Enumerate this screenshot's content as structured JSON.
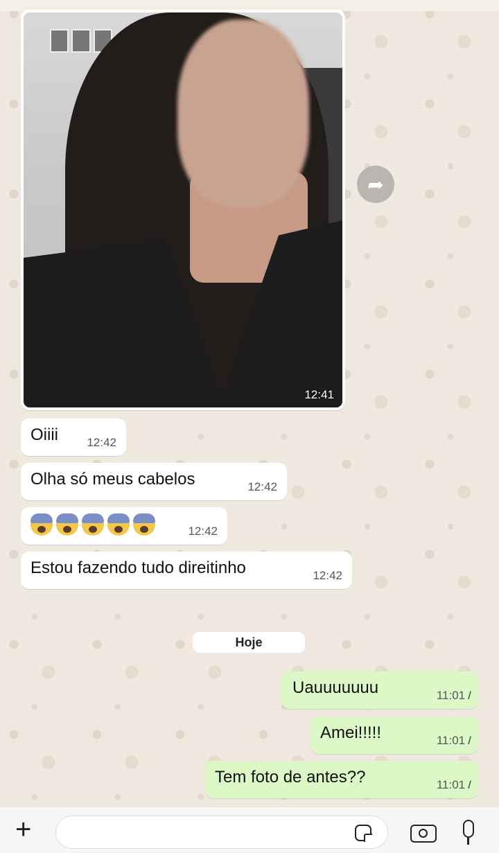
{
  "messages": {
    "photo": {
      "time": "12:41"
    },
    "incoming": [
      {
        "text": "Oiiii",
        "time": "12:42"
      },
      {
        "text": "Olha só meus cabelos",
        "time": "12:42"
      },
      {
        "text": "",
        "time": "12:42"
      },
      {
        "text": "Estou fazendo tudo direitinho",
        "time": "12:42"
      }
    ],
    "day_separator": "Hoje",
    "outgoing": [
      {
        "text": "Uauuuuuuu",
        "time": "11:01"
      },
      {
        "text": "Amei!!!!!",
        "time": "11:01"
      },
      {
        "text": "Tem foto de antes??",
        "time": "11:01"
      }
    ]
  },
  "icons": {
    "forward": "forward-arrow-icon",
    "attach": "plus-icon",
    "sticker": "sticker-icon",
    "camera": "camera-icon",
    "mic": "microphone-icon",
    "read": "double-check-icon"
  },
  "colors": {
    "incoming_bubble": "#ffffff",
    "outgoing_bubble": "#dcf8c6",
    "wallpaper": "#efe9df"
  }
}
